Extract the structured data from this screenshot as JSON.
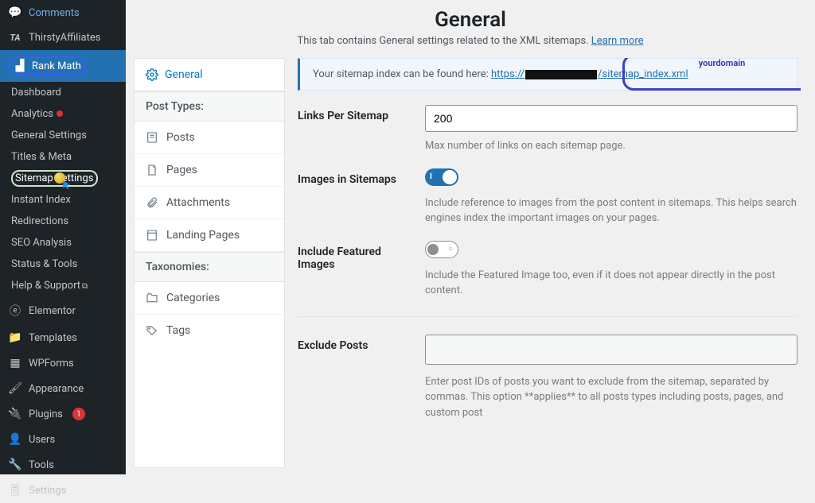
{
  "sidebar": {
    "items": [
      {
        "icon": "comment",
        "label": "Comments"
      },
      {
        "icon": "ta",
        "label": "ThirstyAffiliates"
      },
      {
        "icon": "rank",
        "label": "Rank Math"
      }
    ],
    "subs": [
      {
        "label": "Dashboard"
      },
      {
        "label": "Analytics",
        "dot": true
      },
      {
        "label": "General Settings"
      },
      {
        "label": "Titles & Meta"
      },
      {
        "label": "Sitemap Settings",
        "cursor": true
      },
      {
        "label": "Instant Index",
        "cursor_arrow": true
      },
      {
        "label": "Redirections"
      },
      {
        "label": "SEO Analysis"
      },
      {
        "label": "Status & Tools"
      },
      {
        "label": "Help & Support",
        "ext": true
      }
    ],
    "items2": [
      {
        "icon": "elementor",
        "label": "Elementor"
      },
      {
        "icon": "templates",
        "label": "Templates"
      },
      {
        "icon": "wpforms",
        "label": "WPForms"
      },
      {
        "icon": "brush",
        "label": "Appearance"
      },
      {
        "icon": "plug",
        "label": "Plugins",
        "badge": "1"
      },
      {
        "icon": "user",
        "label": "Users"
      },
      {
        "icon": "wrench",
        "label": "Tools"
      },
      {
        "icon": "sliders",
        "label": "Settings"
      }
    ]
  },
  "header": {
    "title": "General",
    "sub": "This tab contains General settings related to the XML sitemaps.",
    "link": "Learn more"
  },
  "tabs": {
    "active": "General",
    "g1": "Post Types:",
    "g1items": [
      {
        "i": "post",
        "label": "Posts"
      },
      {
        "i": "page",
        "label": "Pages"
      },
      {
        "i": "attach",
        "label": "Attachments"
      },
      {
        "i": "landing",
        "label": "Landing Pages"
      }
    ],
    "g2": "Taxonomies:",
    "g2items": [
      {
        "i": "folder",
        "label": "Categories"
      },
      {
        "i": "tag",
        "label": "Tags"
      }
    ]
  },
  "callout": {
    "pre": "Your sitemap index can be found here: ",
    "url_a": "https://",
    "url_b": "/sitemap_index.xml",
    "domlabel": "yourdomain"
  },
  "fields": {
    "links_label": "Links Per Sitemap",
    "links_value": "200",
    "links_help": "Max number of links on each sitemap page.",
    "images_label": "Images in Sitemaps",
    "images_on": true,
    "images_help": "Include reference to images from the post content in sitemaps. This helps search engines index the important images on your pages.",
    "feat_label": "Include Featured Images",
    "feat_on": false,
    "feat_help": "Include the Featured Image too, even if it does not appear directly in the post content.",
    "excl_label": "Exclude Posts",
    "excl_help": "Enter post IDs of posts you want to exclude from the sitemap, separated by commas. This option **applies** to all posts types including posts, pages, and custom post"
  }
}
